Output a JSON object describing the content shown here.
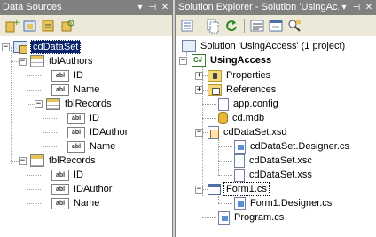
{
  "data_sources": {
    "title": "Data Sources",
    "title_buttons": [
      "▾",
      "⊣",
      "✕"
    ],
    "toolbar_icons": [
      "add-data-source-icon",
      "edit-dataset-icon",
      "configure-dataset-icon",
      "refresh-icon"
    ],
    "tree": {
      "root": "cdDataSet",
      "tblAuthors": "tblAuthors",
      "authors_id": "ID",
      "authors_name": "Name",
      "tblRecords_nested": "tblRecords",
      "nested_id": "ID",
      "nested_idauthor": "IDAuthor",
      "nested_name": "Name",
      "tblRecords": "tblRecords",
      "records_id": "ID",
      "records_idauthor": "IDAuthor",
      "records_name": "Name"
    },
    "field_badge": "abl"
  },
  "solution_explorer": {
    "title": "Solution Explorer - Solution 'UsingAc...",
    "title_buttons": [
      "▾",
      "⊣",
      "✕"
    ],
    "toolbar_icons": [
      "properties-icon",
      "show-all-files-icon",
      "refresh-icon",
      "view-code-icon",
      "view-designer-icon",
      "class-diagram-icon"
    ],
    "tree": {
      "solution": "Solution 'UsingAccess' (1 project)",
      "project": "UsingAccess",
      "properties": "Properties",
      "references": "References",
      "app_config": "app.config",
      "cd_mdb": "cd.mdb",
      "cd_xsd": "cdDataSet.xsd",
      "designer_cs": "cdDataSet.Designer.cs",
      "xsc": "cdDataSet.xsc",
      "xss": "cdDataSet.xss",
      "form1": "Form1.cs",
      "form1_designer": "Form1.Designer.cs",
      "program": "Program.cs"
    }
  },
  "colors": {
    "titlebar": "#808080",
    "selection": "#0a246a",
    "toolbar": "#ece9d8"
  }
}
